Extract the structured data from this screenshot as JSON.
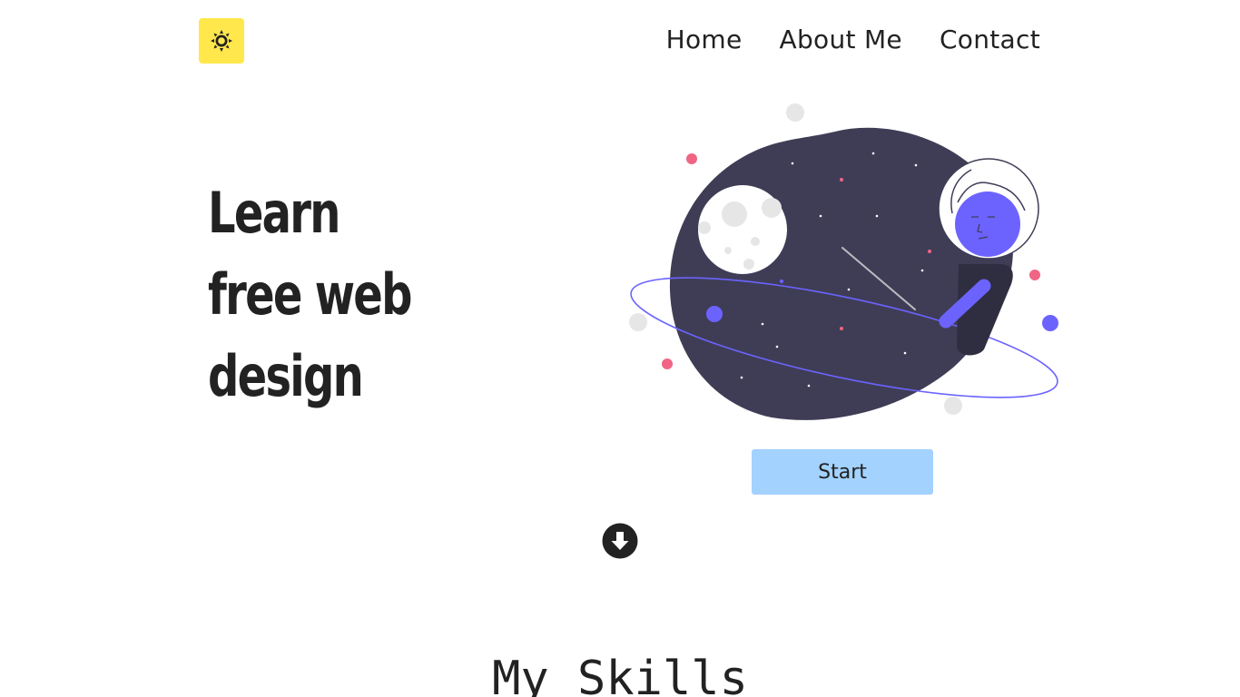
{
  "header": {
    "theme_toggle": {
      "icon": "sun-icon",
      "color": "#ffe74c"
    },
    "nav": [
      {
        "label": "Home"
      },
      {
        "label": "About Me"
      },
      {
        "label": "Contact"
      }
    ]
  },
  "hero": {
    "title_lines": [
      "Learn",
      "free web",
      "design"
    ],
    "start_button": {
      "label": "Start",
      "color": "#a3d2ff"
    },
    "scroll_icon": "arrow-down-circle-icon"
  },
  "skills": {
    "heading": "My Skills"
  },
  "colors": {
    "planet": "#3f3d56",
    "accent": "#6c63ff",
    "star_pink": "#f06584",
    "text": "#222222"
  }
}
